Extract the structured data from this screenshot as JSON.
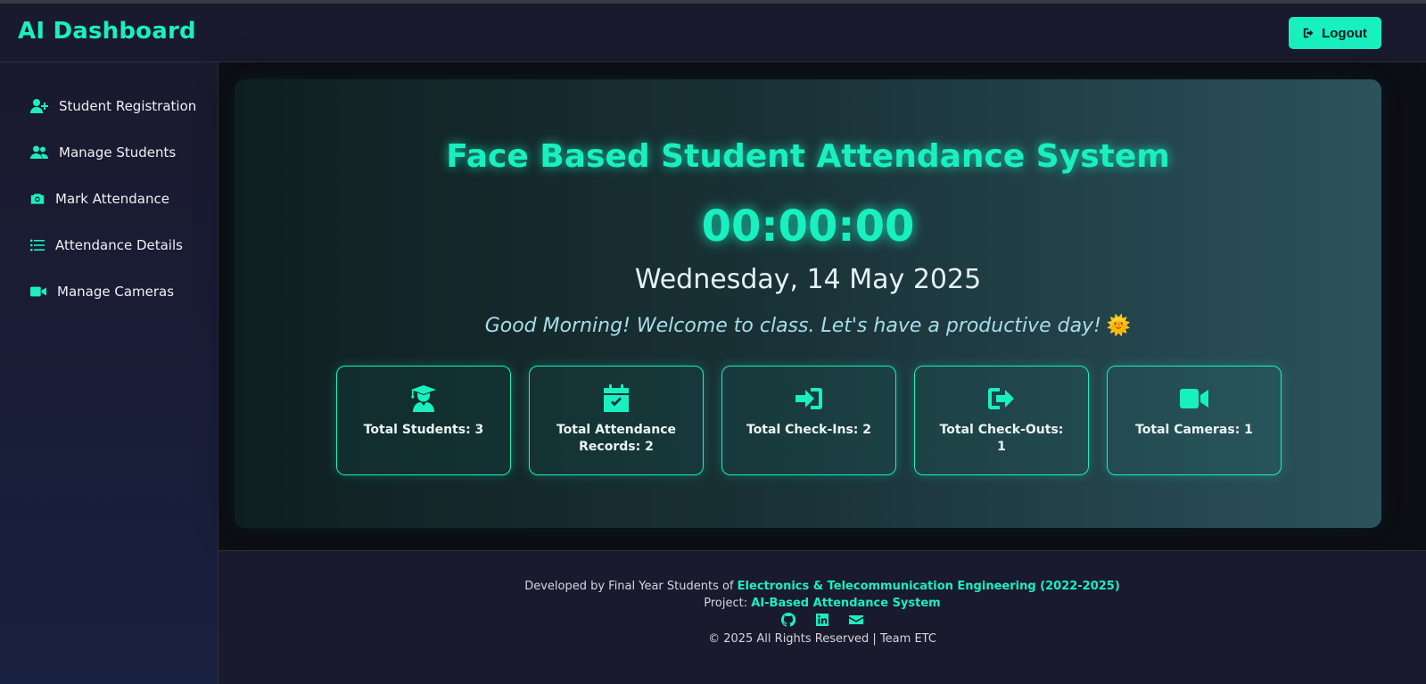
{
  "header": {
    "brand": "AI Dashboard",
    "logout_label": "Logout"
  },
  "sidebar": {
    "items": [
      {
        "label": "Student Registration",
        "icon": "user-plus-icon"
      },
      {
        "label": "Manage Students",
        "icon": "users-icon"
      },
      {
        "label": "Mark Attendance",
        "icon": "camera-icon"
      },
      {
        "label": "Attendance Details",
        "icon": "list-icon"
      },
      {
        "label": "Manage Cameras",
        "icon": "video-icon"
      }
    ]
  },
  "hero": {
    "title": "Face Based Student Attendance System",
    "clock": "00:00:00",
    "date": "Wednesday, 14 May 2025",
    "greeting": "Good Morning! Welcome to class. Let's have a productive day!",
    "greeting_emoji": "🌞"
  },
  "stats": [
    {
      "label": "Total Students: 3",
      "icon": "graduate-icon"
    },
    {
      "label": "Total Attendance Records: 2",
      "icon": "calendar-check-icon"
    },
    {
      "label": "Total Check-Ins: 2",
      "icon": "sign-in-icon"
    },
    {
      "label": "Total Check-Outs: 1",
      "icon": "sign-out-icon"
    },
    {
      "label": "Total Cameras: 1",
      "icon": "video-icon"
    }
  ],
  "footer": {
    "dev_prefix": "Developed by Final Year Students of",
    "dev_dept": "Electronics & Telecommunication Engineering (2022-2025)",
    "project_prefix": "Project:",
    "project_name": "AI-Based Attendance System",
    "icons": [
      "github-icon",
      "linkedin-icon",
      "envelope-icon"
    ],
    "copyright": "© 2025 All Rights Reserved | Team ETC"
  },
  "colors": {
    "accent": "#19f0c0",
    "background": "#14141f",
    "panel": "#1a1a2e"
  }
}
